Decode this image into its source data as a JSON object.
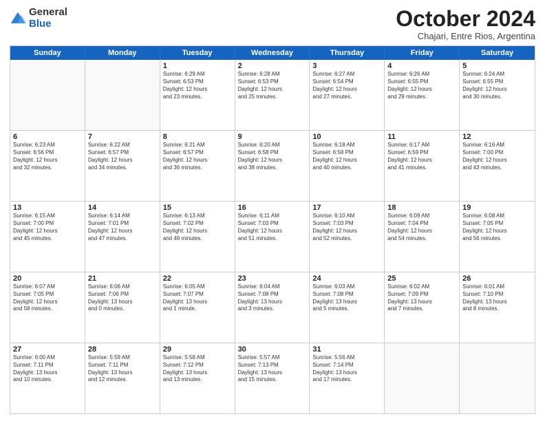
{
  "logo": {
    "general": "General",
    "blue": "Blue"
  },
  "header": {
    "month": "October 2024",
    "subtitle": "Chajari, Entre Rios, Argentina"
  },
  "weekdays": [
    "Sunday",
    "Monday",
    "Tuesday",
    "Wednesday",
    "Thursday",
    "Friday",
    "Saturday"
  ],
  "rows": [
    [
      {
        "day": "",
        "text": "",
        "empty": true
      },
      {
        "day": "",
        "text": "",
        "empty": true
      },
      {
        "day": "1",
        "text": "Sunrise: 6:29 AM\nSunset: 6:53 PM\nDaylight: 12 hours\nand 23 minutes."
      },
      {
        "day": "2",
        "text": "Sunrise: 6:28 AM\nSunset: 6:53 PM\nDaylight: 12 hours\nand 25 minutes."
      },
      {
        "day": "3",
        "text": "Sunrise: 6:27 AM\nSunset: 6:54 PM\nDaylight: 12 hours\nand 27 minutes."
      },
      {
        "day": "4",
        "text": "Sunrise: 6:26 AM\nSunset: 6:55 PM\nDaylight: 12 hours\nand 29 minutes."
      },
      {
        "day": "5",
        "text": "Sunrise: 6:24 AM\nSunset: 6:55 PM\nDaylight: 12 hours\nand 30 minutes."
      }
    ],
    [
      {
        "day": "6",
        "text": "Sunrise: 6:23 AM\nSunset: 6:56 PM\nDaylight: 12 hours\nand 32 minutes."
      },
      {
        "day": "7",
        "text": "Sunrise: 6:22 AM\nSunset: 6:57 PM\nDaylight: 12 hours\nand 34 minutes."
      },
      {
        "day": "8",
        "text": "Sunrise: 6:21 AM\nSunset: 6:57 PM\nDaylight: 12 hours\nand 36 minutes."
      },
      {
        "day": "9",
        "text": "Sunrise: 6:20 AM\nSunset: 6:58 PM\nDaylight: 12 hours\nand 38 minutes."
      },
      {
        "day": "10",
        "text": "Sunrise: 6:18 AM\nSunset: 6:58 PM\nDaylight: 12 hours\nand 40 minutes."
      },
      {
        "day": "11",
        "text": "Sunrise: 6:17 AM\nSunset: 6:59 PM\nDaylight: 12 hours\nand 41 minutes."
      },
      {
        "day": "12",
        "text": "Sunrise: 6:16 AM\nSunset: 7:00 PM\nDaylight: 12 hours\nand 43 minutes."
      }
    ],
    [
      {
        "day": "13",
        "text": "Sunrise: 6:15 AM\nSunset: 7:00 PM\nDaylight: 12 hours\nand 45 minutes."
      },
      {
        "day": "14",
        "text": "Sunrise: 6:14 AM\nSunset: 7:01 PM\nDaylight: 12 hours\nand 47 minutes."
      },
      {
        "day": "15",
        "text": "Sunrise: 6:13 AM\nSunset: 7:02 PM\nDaylight: 12 hours\nand 49 minutes."
      },
      {
        "day": "16",
        "text": "Sunrise: 6:11 AM\nSunset: 7:03 PM\nDaylight: 12 hours\nand 51 minutes."
      },
      {
        "day": "17",
        "text": "Sunrise: 6:10 AM\nSunset: 7:03 PM\nDaylight: 12 hours\nand 52 minutes."
      },
      {
        "day": "18",
        "text": "Sunrise: 6:09 AM\nSunset: 7:04 PM\nDaylight: 12 hours\nand 54 minutes."
      },
      {
        "day": "19",
        "text": "Sunrise: 6:08 AM\nSunset: 7:05 PM\nDaylight: 12 hours\nand 56 minutes."
      }
    ],
    [
      {
        "day": "20",
        "text": "Sunrise: 6:07 AM\nSunset: 7:05 PM\nDaylight: 12 hours\nand 58 minutes."
      },
      {
        "day": "21",
        "text": "Sunrise: 6:06 AM\nSunset: 7:06 PM\nDaylight: 13 hours\nand 0 minutes."
      },
      {
        "day": "22",
        "text": "Sunrise: 6:05 AM\nSunset: 7:07 PM\nDaylight: 13 hours\nand 1 minute."
      },
      {
        "day": "23",
        "text": "Sunrise: 6:04 AM\nSunset: 7:08 PM\nDaylight: 13 hours\nand 3 minutes."
      },
      {
        "day": "24",
        "text": "Sunrise: 6:03 AM\nSunset: 7:08 PM\nDaylight: 13 hours\nand 5 minutes."
      },
      {
        "day": "25",
        "text": "Sunrise: 6:02 AM\nSunset: 7:09 PM\nDaylight: 13 hours\nand 7 minutes."
      },
      {
        "day": "26",
        "text": "Sunrise: 6:01 AM\nSunset: 7:10 PM\nDaylight: 13 hours\nand 8 minutes."
      }
    ],
    [
      {
        "day": "27",
        "text": "Sunrise: 6:00 AM\nSunset: 7:11 PM\nDaylight: 13 hours\nand 10 minutes."
      },
      {
        "day": "28",
        "text": "Sunrise: 5:59 AM\nSunset: 7:11 PM\nDaylight: 13 hours\nand 12 minutes."
      },
      {
        "day": "29",
        "text": "Sunrise: 5:58 AM\nSunset: 7:12 PM\nDaylight: 13 hours\nand 13 minutes."
      },
      {
        "day": "30",
        "text": "Sunrise: 5:57 AM\nSunset: 7:13 PM\nDaylight: 13 hours\nand 15 minutes."
      },
      {
        "day": "31",
        "text": "Sunrise: 5:56 AM\nSunset: 7:14 PM\nDaylight: 13 hours\nand 17 minutes."
      },
      {
        "day": "",
        "text": "",
        "empty": true
      },
      {
        "day": "",
        "text": "",
        "empty": true
      }
    ]
  ]
}
